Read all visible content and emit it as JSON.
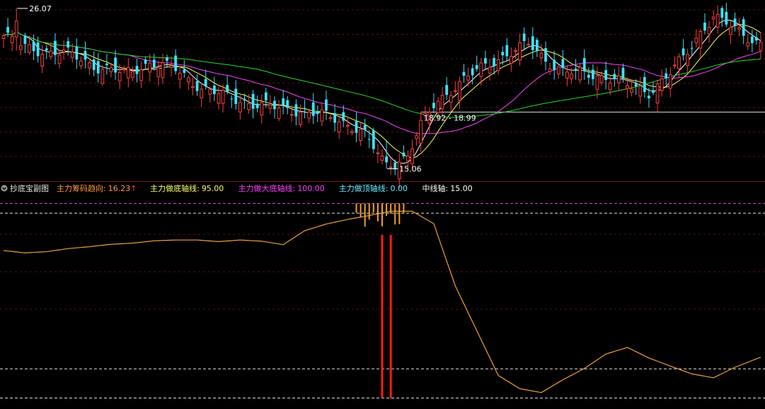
{
  "colors": {
    "background": "#000000",
    "grid": "#5a1010",
    "up": "#ff3b3b",
    "down": "#39e5ff",
    "ma5": "#ffffff",
    "ma10": "#ffff55",
    "ma30": "#ff40ff",
    "ma60": "#22dd22",
    "indicator": "#f0a030",
    "signal": "#ff1a1a",
    "label_orange": "#ff9a3c",
    "label_yellow": "#ffff66",
    "label_magenta": "#ff40ff",
    "label_cyan": "#66eeff",
    "label_white": "#ffffff"
  },
  "price_panel": {
    "high_label": "26.07",
    "low_label": "15.06",
    "range_label": "18.92 - 18.99"
  },
  "indicator_panel": {
    "title": "抄底宝副图",
    "items": [
      {
        "label": "主力筹码趋向:",
        "value": "16.23",
        "arrow": "↑",
        "color": "label_orange"
      },
      {
        "label": "主力做底轴线:",
        "value": "95.00",
        "color": "label_yellow"
      },
      {
        "label": "主力做大底轴线:",
        "value": "100.00",
        "color": "label_magenta"
      },
      {
        "label": "主力做顶轴线:",
        "value": "0.00",
        "color": "label_cyan"
      },
      {
        "label": "中线轴:",
        "value": "15.00",
        "color": "label_white"
      }
    ]
  },
  "chart_data": [
    {
      "type": "candlestick",
      "y_range": [
        14.5,
        26.5
      ],
      "anchors": {
        "high": 26.07,
        "low": 15.06,
        "reference": 18.95
      },
      "close_path": [
        [
          0,
          24.2
        ],
        [
          5,
          23.4
        ],
        [
          10,
          23.1
        ],
        [
          16,
          22.9
        ],
        [
          22,
          22.0
        ],
        [
          28,
          21.6
        ],
        [
          34,
          22.3
        ],
        [
          40,
          21.9
        ],
        [
          46,
          20.6
        ],
        [
          52,
          20.0
        ],
        [
          58,
          19.5
        ],
        [
          64,
          19.2
        ],
        [
          70,
          19.0
        ],
        [
          76,
          18.6
        ],
        [
          81,
          18.0
        ],
        [
          84,
          17.4
        ],
        [
          88,
          15.6
        ],
        [
          91,
          15.4
        ],
        [
          94,
          16.0
        ],
        [
          97,
          18.0
        ],
        [
          100,
          19.4
        ],
        [
          104,
          20.5
        ],
        [
          108,
          21.4
        ],
        [
          112,
          22.1
        ],
        [
          118,
          23.1
        ],
        [
          122,
          23.6
        ],
        [
          126,
          22.5
        ],
        [
          130,
          21.8
        ],
        [
          136,
          21.5
        ],
        [
          142,
          21.3
        ],
        [
          146,
          20.6
        ],
        [
          150,
          20.3
        ],
        [
          154,
          21.4
        ],
        [
          158,
          22.6
        ],
        [
          162,
          24.4
        ],
        [
          165,
          25.6
        ],
        [
          168,
          25.0
        ],
        [
          172,
          24.2
        ],
        [
          176,
          23.7
        ]
      ],
      "series": [
        {
          "name": "MA5",
          "window": 5
        },
        {
          "name": "MA10",
          "window": 10
        },
        {
          "name": "MA30",
          "window": 30
        },
        {
          "name": "MA60",
          "window": 60
        }
      ]
    },
    {
      "type": "line",
      "y_range": [
        -2,
        102
      ],
      "reference_lines": [
        100,
        95,
        15,
        0
      ],
      "curve": [
        [
          0,
          75.8
        ],
        [
          5,
          74.6
        ],
        [
          10,
          75.2
        ],
        [
          15,
          76.8
        ],
        [
          20,
          77.8
        ],
        [
          25,
          79.0
        ],
        [
          30,
          79.6
        ],
        [
          35,
          80.8
        ],
        [
          40,
          81.2
        ],
        [
          45,
          81.2
        ],
        [
          50,
          80.4
        ],
        [
          55,
          81.2
        ],
        [
          60,
          80.6
        ],
        [
          65,
          78.8
        ],
        [
          70,
          86.0
        ],
        [
          75,
          89.4
        ],
        [
          80,
          91.8
        ],
        [
          85,
          93.8
        ],
        [
          90,
          96.0
        ],
        [
          95,
          96.0
        ],
        [
          100,
          89.6
        ],
        [
          105,
          57.6
        ],
        [
          110,
          34.6
        ],
        [
          115,
          11.6
        ],
        [
          120,
          4.8
        ],
        [
          125,
          2.8
        ],
        [
          130,
          9.4
        ],
        [
          135,
          15.2
        ],
        [
          140,
          22.6
        ],
        [
          145,
          26.0
        ],
        [
          150,
          20.6
        ],
        [
          155,
          16.4
        ],
        [
          160,
          12.4
        ],
        [
          165,
          10.4
        ],
        [
          170,
          15.8
        ],
        [
          176,
          21.0
        ]
      ],
      "top_bars": {
        "from": 82,
        "to": 93,
        "min": 92,
        "max": 99.5
      },
      "signal_bars": [
        88,
        90
      ]
    }
  ]
}
